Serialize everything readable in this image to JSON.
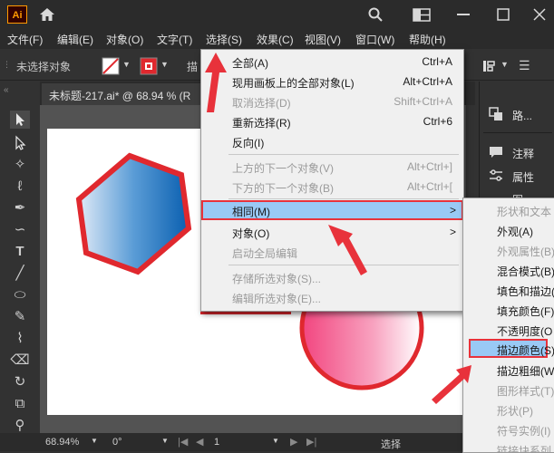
{
  "app": {
    "logo": "Ai"
  },
  "menubar": {
    "items": [
      "文件(F)",
      "编辑(E)",
      "对象(O)",
      "文字(T)",
      "选择(S)",
      "效果(C)",
      "视图(V)",
      "窗口(W)",
      "帮助(H)"
    ]
  },
  "controlbar": {
    "selection_status": "未选择对象",
    "truncated_label": "描"
  },
  "document": {
    "tab_title": "未标题-217.ai* @ 68.94 % (R"
  },
  "select_menu": {
    "all": {
      "label": "全部(A)",
      "shortcut": "Ctrl+A"
    },
    "all_on_artboard": {
      "label": "现用画板上的全部对象(L)",
      "shortcut": "Alt+Ctrl+A"
    },
    "deselect": {
      "label": "取消选择(D)",
      "shortcut": "Shift+Ctrl+A"
    },
    "reselect": {
      "label": "重新选择(R)",
      "shortcut": "Ctrl+6"
    },
    "inverse": {
      "label": "反向(I)",
      "shortcut": ""
    },
    "next_above": {
      "label": "上方的下一个对象(V)",
      "shortcut": "Alt+Ctrl+]"
    },
    "next_below": {
      "label": "下方的下一个对象(B)",
      "shortcut": "Alt+Ctrl+["
    },
    "same": {
      "label": "相同(M)",
      "arrow": ">"
    },
    "object": {
      "label": "对象(O)",
      "arrow": ">"
    },
    "global_edit": {
      "label": "启动全局编辑"
    },
    "save_selection": {
      "label": "存储所选对象(S)..."
    },
    "edit_selection": {
      "label": "编辑所选对象(E)..."
    }
  },
  "same_submenu": {
    "items": [
      "形状和文本",
      "外观(A)",
      "外观属性(B)",
      "混合模式(B)",
      "填色和描边(",
      "填充颜色(F)",
      "不透明度(O",
      "描边颜色(S)",
      "描边粗细(W",
      "图形样式(T)",
      "形状(P)",
      "符号实例(I)",
      "链接块系列"
    ]
  },
  "right_panel": {
    "items": [
      "路...",
      "注释",
      "属性",
      "图"
    ]
  },
  "statusbar": {
    "zoom": "68.94%",
    "rotation": "0°",
    "artboard": "1",
    "tool": "选择"
  },
  "colors": {
    "accent_red": "#e8323b",
    "highlight_blue": "#99c9f5"
  }
}
